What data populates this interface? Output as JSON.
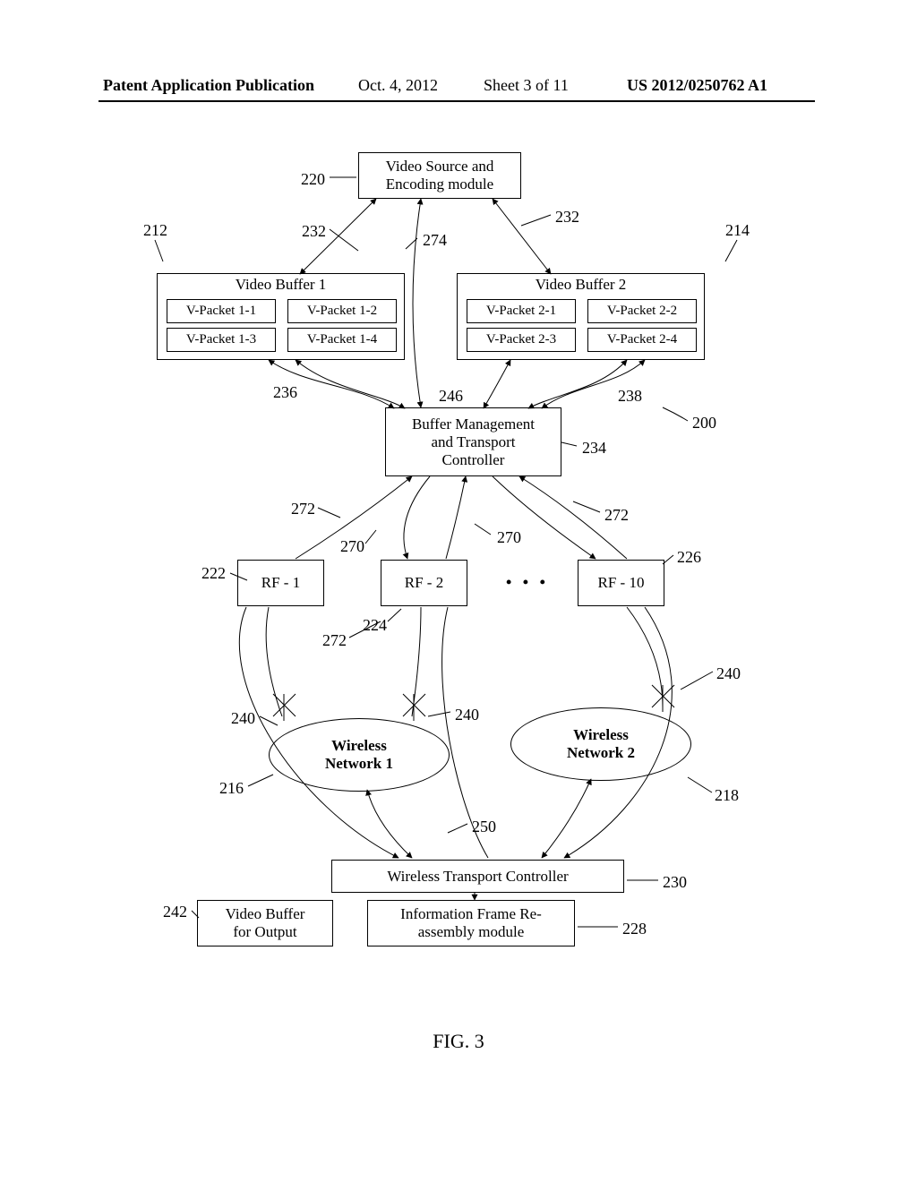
{
  "header": {
    "publication": "Patent Application Publication",
    "date": "Oct. 4, 2012",
    "sheet": "Sheet 3 of 11",
    "number": "US 2012/0250762 A1"
  },
  "figure_caption": "FIG. 3",
  "blocks": {
    "video_source": "Video Source and\nEncoding module",
    "vbuf1_title": "Video Buffer 1",
    "vbuf2_title": "Video Buffer 2",
    "vb1p1": "V-Packet 1-1",
    "vb1p2": "V-Packet 1-2",
    "vb1p3": "V-Packet 1-3",
    "vb1p4": "V-Packet 1-4",
    "vb2p1": "V-Packet 2-1",
    "vb2p2": "V-Packet 2-2",
    "vb2p3": "V-Packet 2-3",
    "vb2p4": "V-Packet 2-4",
    "bmtc": "Buffer Management\nand Transport\nController",
    "rf1": "RF - 1",
    "rf2": "RF - 2",
    "rf10": "RF - 10",
    "wnet1": "Wireless\nNetwork 1",
    "wnet2": "Wireless\nNetwork 2",
    "wtc": "Wireless Transport Controller",
    "vbuf_out": "Video Buffer\nfor Output",
    "reassembly": "Information Frame Re-\nassembly module"
  },
  "reflabels": {
    "r220": "220",
    "r232a": "232",
    "r232b": "232",
    "r274": "274",
    "r212": "212",
    "r214": "214",
    "r236": "236",
    "r238": "238",
    "r246": "246",
    "r200": "200",
    "r234": "234",
    "r272a": "272",
    "r272b": "272",
    "r272c": "272",
    "r270a": "270",
    "r270b": "270",
    "r222": "222",
    "r224": "224",
    "r226": "226",
    "r216": "216",
    "r218": "218",
    "r240a": "240",
    "r240b": "240",
    "r240c": "240",
    "r250": "250",
    "r230": "230",
    "r228": "228",
    "r242": "242"
  },
  "dots": "• • •"
}
